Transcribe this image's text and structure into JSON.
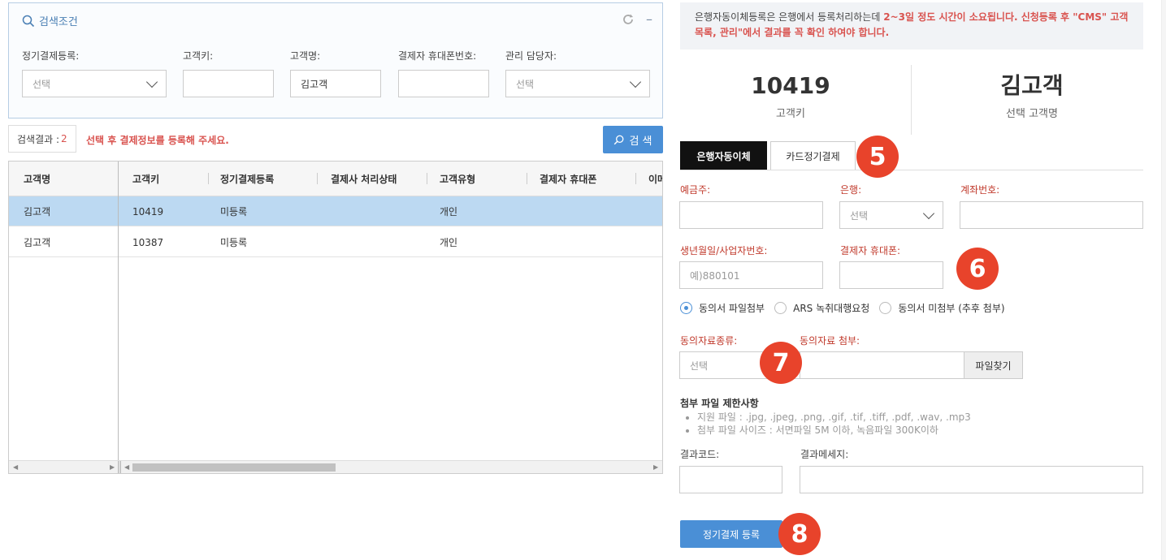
{
  "search": {
    "title": "검색조건",
    "fields": [
      {
        "label": "정기결제등록:",
        "value": "선택"
      },
      {
        "label": "고객키:",
        "value": ""
      },
      {
        "label": "고객명:",
        "value": "김고객"
      },
      {
        "label": "결제자 휴대폰번호:",
        "value": ""
      },
      {
        "label": "관리 담당자:",
        "value": "선택"
      }
    ],
    "result_label": "검색결과 :",
    "result_count": "2",
    "result_hint": "선택 후 결제정보를 등록해 주세요.",
    "button_label": "검 색"
  },
  "grid": {
    "columns": [
      "고객명",
      "고객키",
      "정기결제등록",
      "결제사 처리상태",
      "고객유형",
      "결제자 휴대폰",
      "이메"
    ],
    "rows": [
      {
        "name": "김고객",
        "key": "10419",
        "reg": "미등록",
        "status": "",
        "type": "개인",
        "phone": ""
      },
      {
        "name": "김고객",
        "key": "10387",
        "reg": "미등록",
        "status": "",
        "type": "개인",
        "phone": ""
      }
    ],
    "selected_row": 0
  },
  "notice": {
    "text1": "은행자동이체등록은 은행에서 등록처리하는데 ",
    "text_red": "2~3일 정도 시간이 소요됩니다. 신청등록 후 \"CMS\" 고객목록, 관리\"에서 결과를 꼭 확인 하여야 합니다."
  },
  "summary": {
    "key_value": "10419",
    "key_label": "고객키",
    "name_value": "김고객",
    "name_label": "선택 고객명"
  },
  "tabs": [
    {
      "label": "은행자동이체",
      "active": true
    },
    {
      "label": "카드정기결제",
      "active": false
    }
  ],
  "form": {
    "depositor_label": "예금주:",
    "bank_label": "은행:",
    "bank_value": "선택",
    "account_label": "계좌번호:",
    "birth_label": "생년월일/사업자번호:",
    "birth_placeholder": "예)880101",
    "phone_label": "결제자 휴대폰:",
    "radio_options": [
      {
        "label": "동의서 파일첨부",
        "checked": true
      },
      {
        "label": "ARS 녹취대행요청",
        "checked": false
      },
      {
        "label": "동의서 미첨부 (추후 첨부)",
        "checked": false
      }
    ],
    "consent_type_label": "동의자료종류:",
    "consent_type_value": "선택",
    "consent_file_label": "동의자료 첨부:",
    "file_button": "파일찾기",
    "limits_title": "첨부 파일 제한사항",
    "limits": [
      "지원 파일 : .jpg, .jpeg, .png, .gif, .tif, .tiff, .pdf, .wav, .mp3",
      "첨부 파일 사이즈 : 서면파일 5M 이하, 녹음파일 300K이하"
    ],
    "result_code_label": "결과코드:",
    "result_msg_label": "결과메세지:",
    "submit_label": "정기결제 등록"
  },
  "badges": [
    "5",
    "6",
    "7",
    "8"
  ],
  "colors": {
    "accent": "#4a8fd6",
    "alert": "#d9534f",
    "badge": "#e8432b",
    "selected_row": "#bcd9f2"
  }
}
